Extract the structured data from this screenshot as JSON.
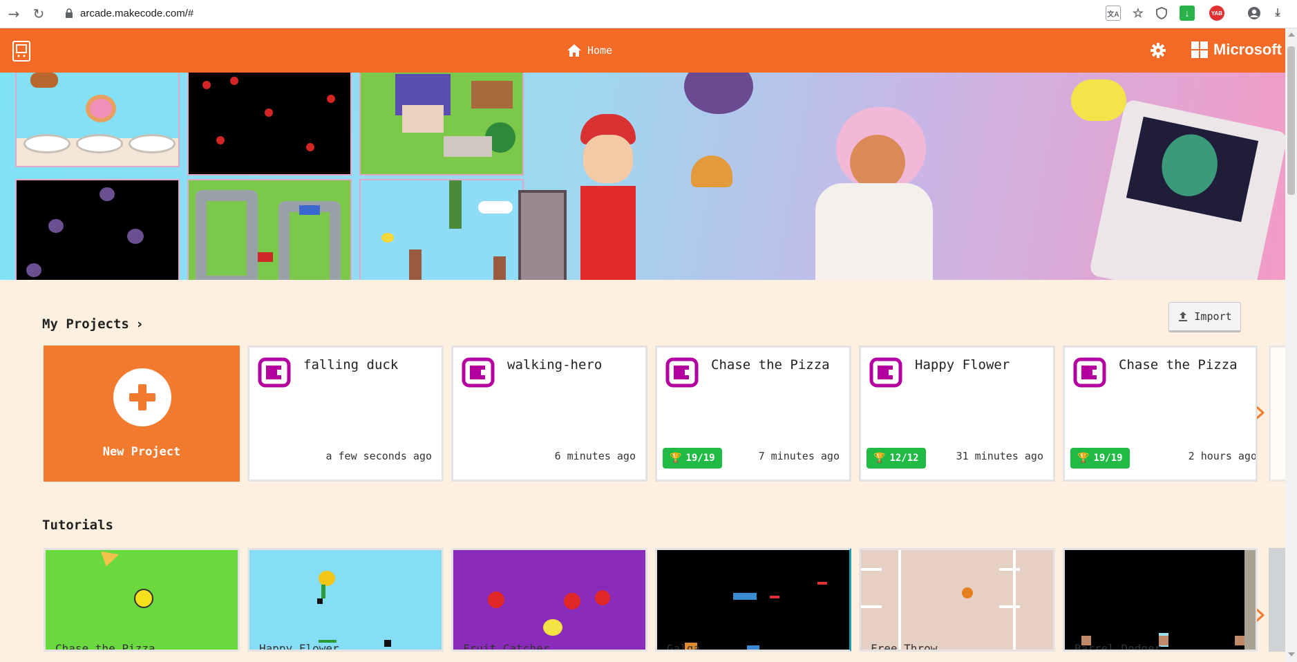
{
  "browser": {
    "url": "arcade.makecode.com/#",
    "ext_badge": "YAB"
  },
  "header": {
    "home_label": "Home",
    "brand": "Microsoft",
    "color": "#f26a26"
  },
  "my_projects": {
    "title": "My Projects",
    "import_label": "Import",
    "new_project_label": "New Project",
    "projects": [
      {
        "name": "falling duck",
        "time": "a few seconds ago",
        "badge": ""
      },
      {
        "name": "walking-hero",
        "time": "6 minutes ago",
        "badge": ""
      },
      {
        "name": "Chase the Pizza",
        "time": "7 minutes ago",
        "badge": "19/19"
      },
      {
        "name": "Happy Flower",
        "time": "31 minutes ago",
        "badge": "12/12"
      },
      {
        "name": "Chase the Pizza",
        "time": "2 hours ago",
        "badge": "19/19"
      }
    ]
  },
  "tutorials": {
    "title": "Tutorials",
    "items": [
      {
        "name": "Chase the Pizza",
        "bg": "#6ad83f"
      },
      {
        "name": "Happy Flower",
        "bg": "#85ddf6"
      },
      {
        "name": "Fruit Catcher",
        "bg": "#8b2bb9"
      },
      {
        "name": "Galga",
        "bg": "#000000"
      },
      {
        "name": "Free Throw",
        "bg": "#e5d0c3"
      },
      {
        "name": "Barrel Dodger",
        "bg": "#000000"
      }
    ]
  },
  "icons": {
    "back": "arrow-right-icon",
    "reload": "reload-icon",
    "home": "home-icon",
    "settings": "gear-icon",
    "import": "upload-icon",
    "trophy": "trophy-icon"
  }
}
